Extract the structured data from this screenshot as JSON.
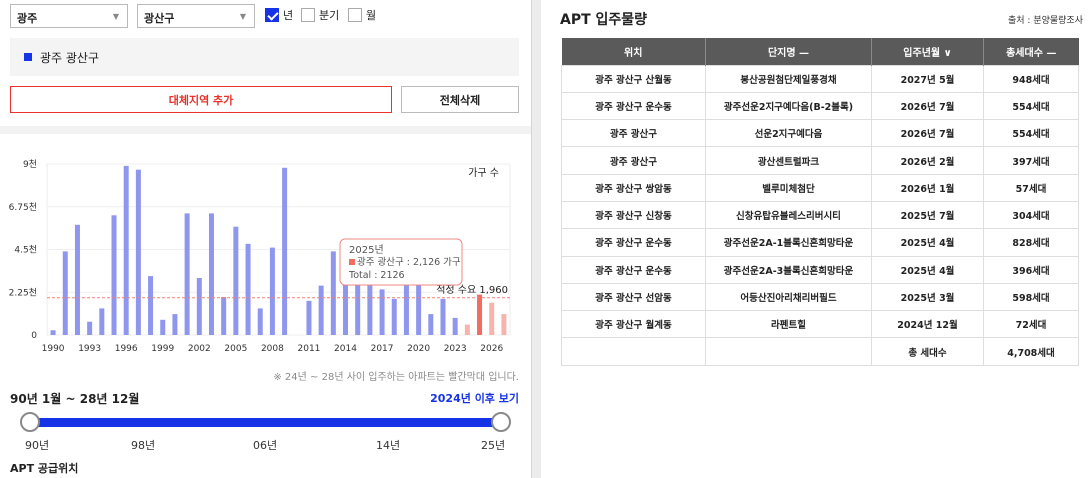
{
  "filters": {
    "city": "광주",
    "district": "광산구",
    "periods": [
      {
        "label": "년",
        "checked": true
      },
      {
        "label": "분기",
        "checked": false
      },
      {
        "label": "월",
        "checked": false
      }
    ]
  },
  "selected_region": "광주 광산구",
  "buttons": {
    "add_region": "대체지역 추가",
    "clear_all": "전체삭제"
  },
  "chart_data": {
    "type": "bar",
    "x": [
      1990,
      1991,
      1992,
      1993,
      1994,
      1995,
      1996,
      1997,
      1998,
      1999,
      2000,
      2001,
      2002,
      2003,
      2004,
      2005,
      2006,
      2007,
      2008,
      2009,
      2010,
      2011,
      2012,
      2013,
      2014,
      2015,
      2016,
      2017,
      2018,
      2019,
      2020,
      2021,
      2022,
      2023,
      2024,
      2025,
      2026,
      2027
    ],
    "values": [
      250,
      4400,
      5800,
      700,
      1400,
      6300,
      8900,
      8700,
      3100,
      800,
      1100,
      6400,
      3000,
      6400,
      2000,
      5700,
      4800,
      1400,
      4600,
      8800,
      0,
      1800,
      2600,
      4400,
      3500,
      3600,
      2900,
      2400,
      1900,
      3800,
      3400,
      1100,
      1900,
      900,
      550,
      2126,
      1700,
      1100
    ],
    "future_from": 2024,
    "x_ticks": [
      "1990",
      "1993",
      "1996",
      "1999",
      "2002",
      "2005",
      "2008",
      "2011",
      "2014",
      "2017",
      "2020",
      "2023",
      "2026"
    ],
    "y_ticks": [
      "0",
      "2.25천",
      "4.5천",
      "6.75천",
      "9천"
    ],
    "ylim": [
      0,
      9000
    ],
    "unit_label": "가구 수",
    "reference_line": {
      "value": 1960,
      "label": "적정 수요 1,960"
    },
    "tooltip": {
      "year": "2025년",
      "series_line": "광주 광산구 : 2,126 가구",
      "total_line": "Total : 2126"
    },
    "colors": {
      "past": "#8e96ee",
      "future_current": "#f46b62",
      "future": "#f8b3ad",
      "reference": "#f0807a"
    }
  },
  "note": "※ 24년 ~ 28년 사이 입주하는 아파트는 빨간막대 입니다.",
  "range": {
    "title": "90년 1월 ~ 28년 12월",
    "after_link": "2024년 이후 보기",
    "labels": [
      "90년",
      "98년",
      "06년",
      "14년",
      "25년"
    ]
  },
  "supply_location_title": "APT 공급위치",
  "table": {
    "title": "APT 입주물량",
    "source": "출처 : 분양물량조사",
    "headers": [
      "위치",
      "단지명 —",
      "입주년월 ∨",
      "총세대수 —"
    ],
    "rows": [
      [
        "광주 광산구 산월동",
        "봉산공원첨단제일풍경채",
        "2027년 5월",
        "948세대"
      ],
      [
        "광주 광산구 운수동",
        "광주선운2지구예다음(B-2블록)",
        "2026년 7월",
        "554세대"
      ],
      [
        "광주 광산구",
        "선운2지구예다음",
        "2026년 7월",
        "554세대"
      ],
      [
        "광주 광산구",
        "광산센트럴파크",
        "2026년 2월",
        "397세대"
      ],
      [
        "광주 광산구 쌍암동",
        "벨루미체첨단",
        "2026년 1월",
        "57세대"
      ],
      [
        "광주 광산구 신창동",
        "신창유탑유블레스리버시티",
        "2025년 7월",
        "304세대"
      ],
      [
        "광주 광산구 운수동",
        "광주선운2A-1블록신혼희망타운",
        "2025년 4월",
        "828세대"
      ],
      [
        "광주 광산구 운수동",
        "광주선운2A-3블록신혼희망타운",
        "2025년 4월",
        "396세대"
      ],
      [
        "광주 광산구 선암동",
        "어등산진아리채리버필드",
        "2025년 3월",
        "598세대"
      ],
      [
        "광주 광산구 월계동",
        "라펜트힐",
        "2024년 12월",
        "72세대"
      ]
    ],
    "total_label": "총 세대수",
    "total_value": "4,708세대"
  }
}
